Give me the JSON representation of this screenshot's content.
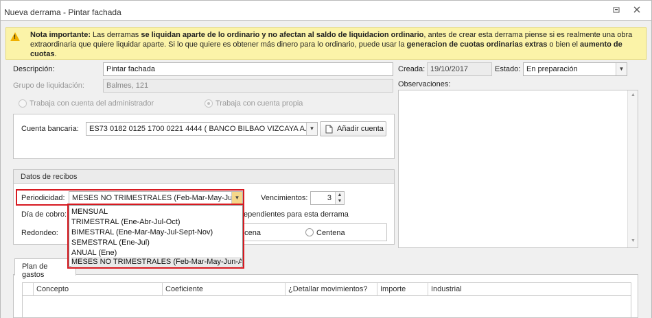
{
  "window": {
    "title": "Nueva derrama - Pintar fachada",
    "icons": {
      "restore": "restore-icon",
      "close": "close-icon"
    }
  },
  "note": {
    "icon": "warning-icon",
    "prefix_bold": "Nota importante:",
    "t1": " Las derramas ",
    "b1": "se liquidan aparte de lo ordinario y no afectan al saldo de liquidacion ordinario",
    "t2": ", antes de crear esta derrama piense si es realmente una obra extraordinaria que quiere liquidar aparte. Si lo que quiere es obtener más dinero para lo ordinario, puede usar la ",
    "b2": "generacion de cuotas ordinarias extras",
    "t3": " o bien el ",
    "b3": "aumento de cuotas",
    "t4": "."
  },
  "form": {
    "descripcion_label": "Descripción:",
    "descripcion_value": "Pintar fachada",
    "grupo_label": "Grupo de liquidación:",
    "grupo_value": "Balmes, 121",
    "radio_admin": "Trabaja con cuenta del administrador",
    "radio_propia": "Trabaja con cuenta propia",
    "creada_label": "Creada:",
    "creada_value": "19/10/2017",
    "estado_label": "Estado:",
    "estado_value": "En preparación",
    "observaciones_label": "Observaciones:"
  },
  "cuenta": {
    "label": "Cuenta bancaria:",
    "value": "ES73 0182 0125 1700 0221 4444 ( BANCO BILBAO VIZCAYA A...",
    "add_button": "Añadir cuenta",
    "add_icon": "document-icon"
  },
  "recibos": {
    "header": "Datos de recibos",
    "periodicidad_label": "Periodicidad:",
    "periodicidad_value": "MESES NO TRIMESTRALES (Feb-Mar-May-Jun...",
    "vencimientos_label": "Vencimientos:",
    "vencimientos_value": "3",
    "dia_cobro_label": "Día de cobro:",
    "pendientes_text": "ependientes para esta derrama",
    "redondeo_label": "Redondeo:",
    "decena_partial": "ecena",
    "centena_label": "Centena"
  },
  "dropdown": {
    "options": [
      "MENSUAL",
      "TRIMESTRAL (Ene-Abr-Jul-Oct)",
      "BIMESTRAL (Ene-Mar-May-Jul-Sept-Nov)",
      "SEMESTRAL (Ene-Jul)",
      "ANUAL (Ene)",
      "MESES NO TRIMESTRALES (Feb-Mar-May-Jun-A..."
    ],
    "selected_index": 5
  },
  "plan": {
    "tab_label": "Plan de gastos",
    "columns": [
      "Concepto",
      "Coeficiente",
      "¿Detallar movimientos?",
      "Importe",
      "Industrial"
    ]
  },
  "colors": {
    "highlight": "#d71920",
    "note_bg": "#fbf3a8",
    "combo_arrow_bg": "#f5d78a"
  }
}
